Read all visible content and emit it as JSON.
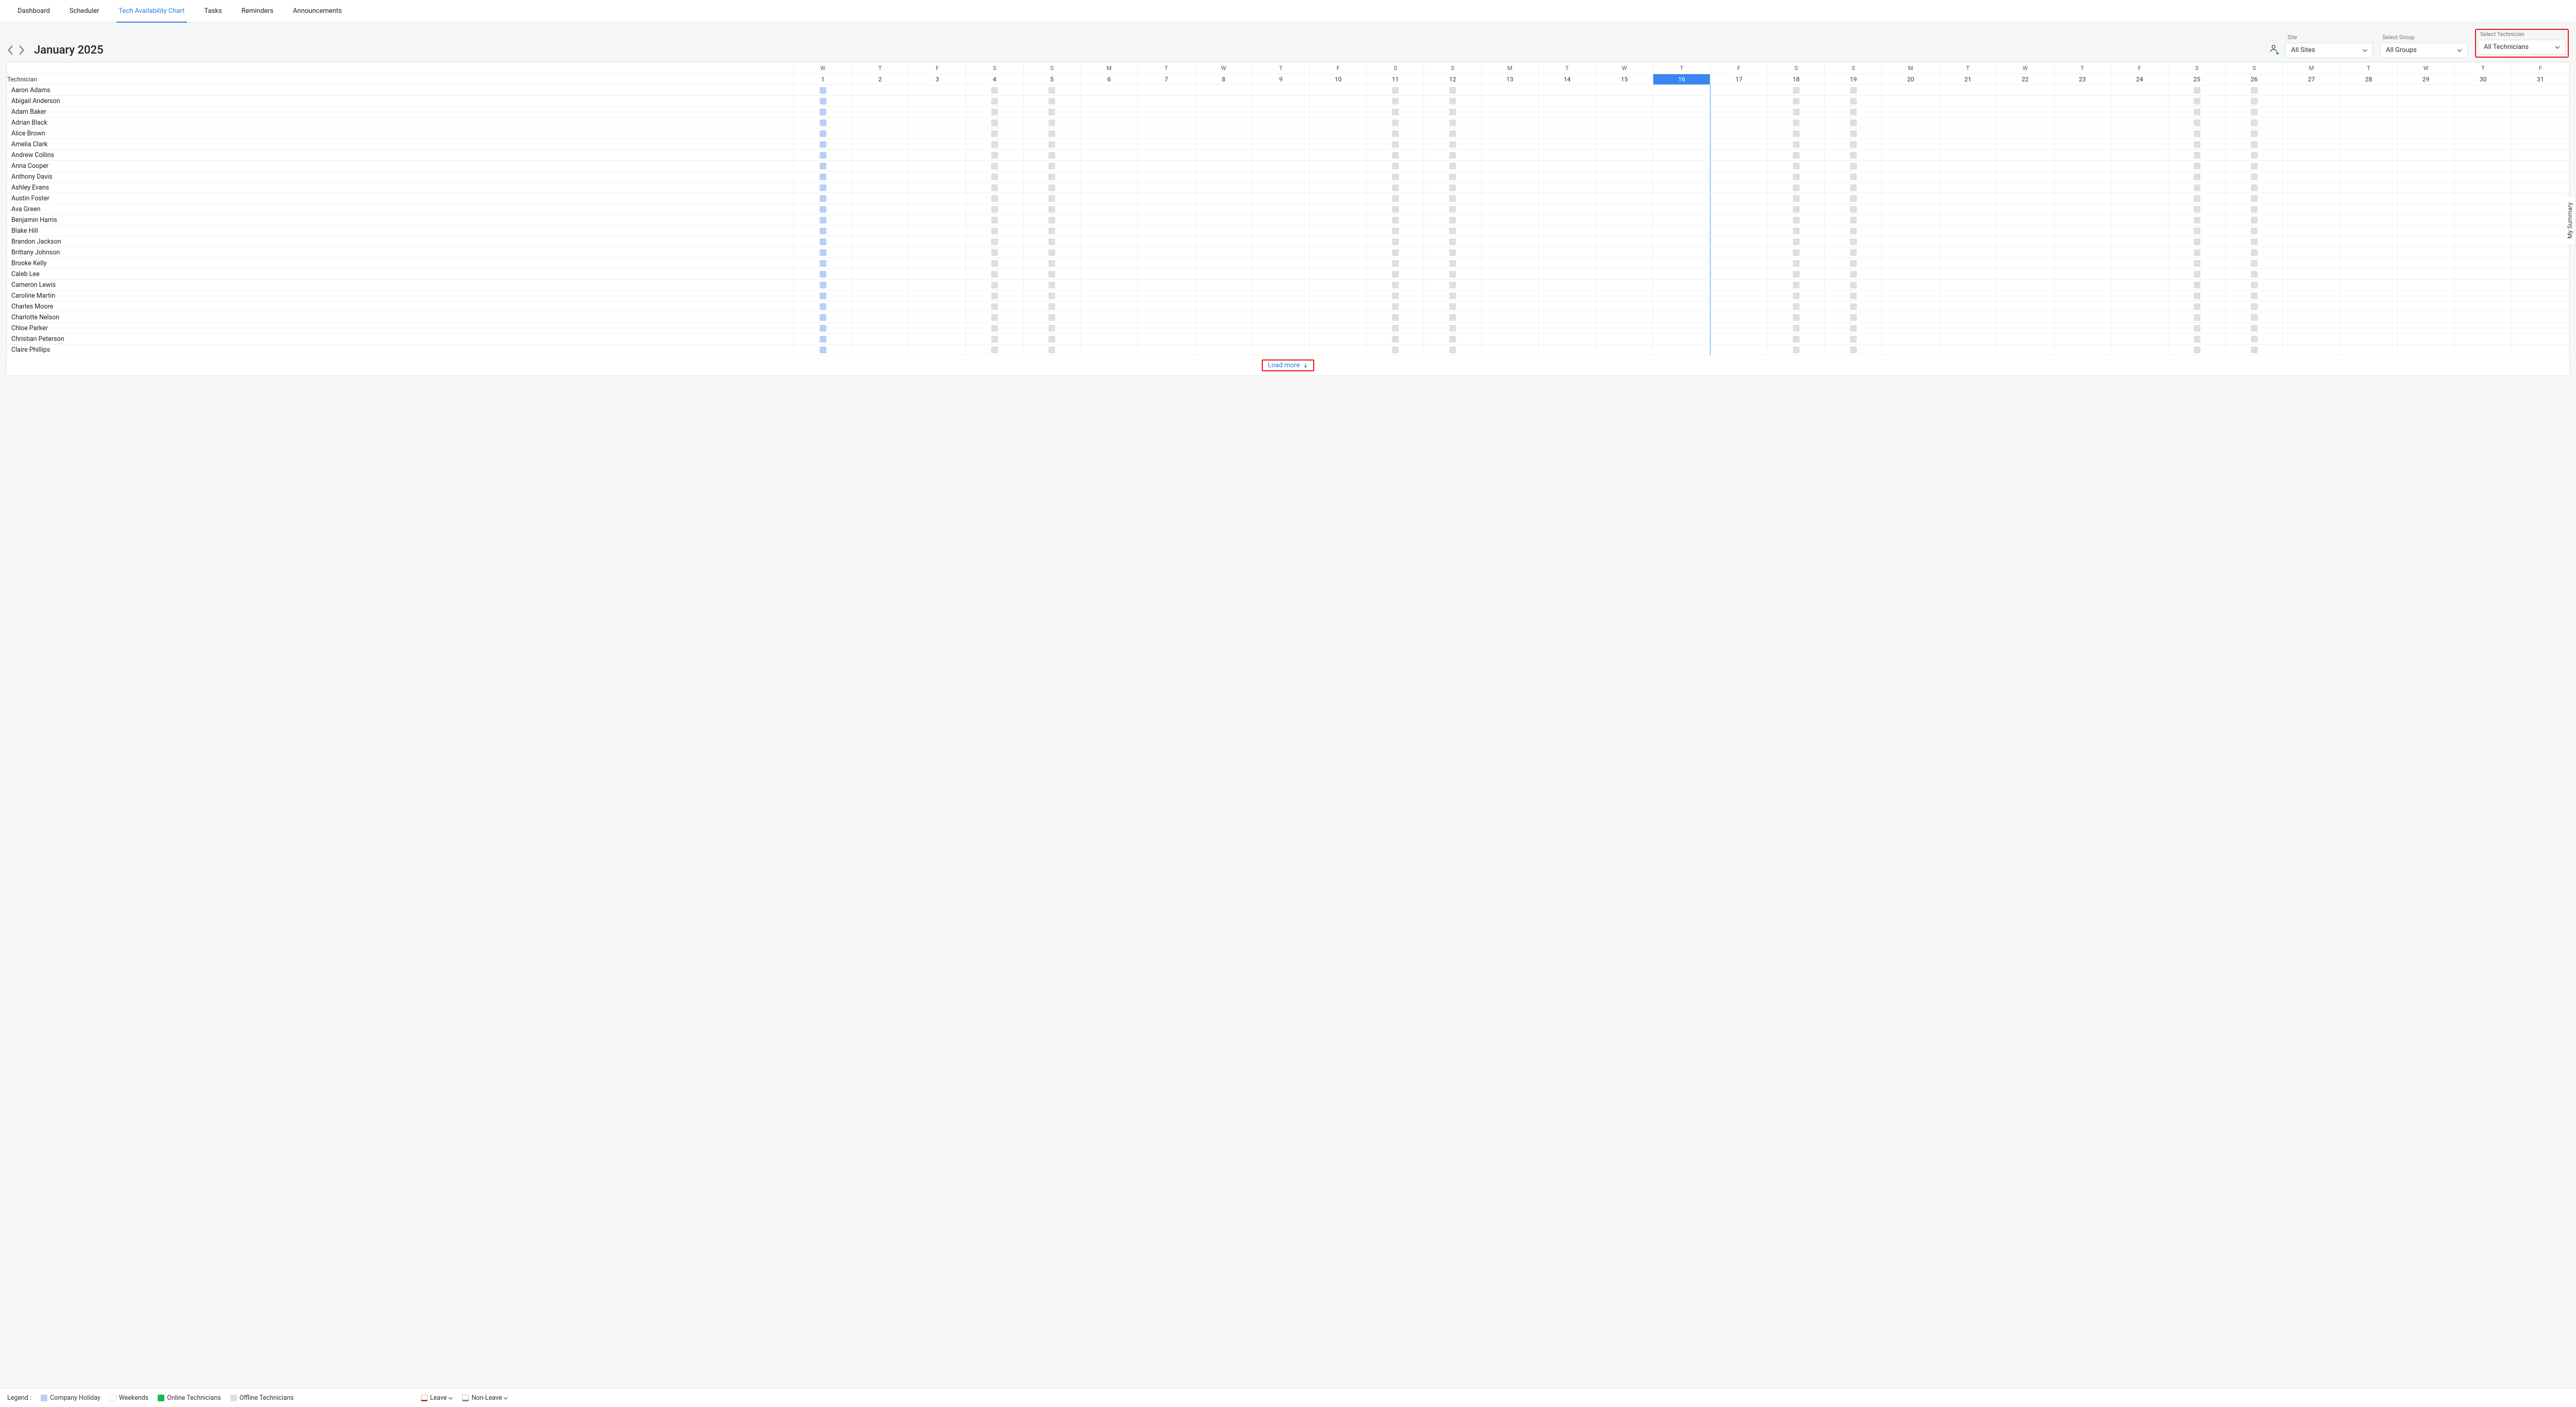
{
  "tabs": [
    "Dashboard",
    "Scheduler",
    "Tech Availability Chart",
    "Tasks",
    "Reminders",
    "Announcements"
  ],
  "activeTab": 2,
  "month": "January 2025",
  "filters": {
    "site": {
      "label": "Site",
      "value": "All Sites"
    },
    "group": {
      "label": "Select Group",
      "value": "All Groups"
    },
    "tech": {
      "label": "Select Technician",
      "value": "All Technicians"
    }
  },
  "technicianColHeader": "Technician",
  "weekdays": [
    "W",
    "T",
    "F",
    "S",
    "S",
    "M",
    "T",
    "W",
    "T",
    "F",
    "S",
    "S",
    "M",
    "T",
    "W",
    "T",
    "F",
    "S",
    "S",
    "M",
    "T",
    "W",
    "T",
    "F",
    "S",
    "S",
    "M",
    "T",
    "W",
    "T",
    "F"
  ],
  "dates": [
    1,
    2,
    3,
    4,
    5,
    6,
    7,
    8,
    9,
    10,
    11,
    12,
    13,
    14,
    15,
    16,
    17,
    18,
    19,
    20,
    21,
    22,
    23,
    24,
    25,
    26,
    27,
    28,
    29,
    30,
    31
  ],
  "today": 16,
  "holidayCols": [
    1
  ],
  "weekendCols": [
    4,
    5,
    11,
    12,
    18,
    19,
    25,
    26
  ],
  "technicians": [
    "Aaron Adams",
    "Abigail Anderson",
    "Adam Baker",
    "Adrian Black",
    "Alice Brown",
    "Amelia Clark",
    "Andrew Collins",
    "Anna Cooper",
    "Anthony Davis",
    "Ashley Evans",
    "Austin Foster",
    "Ava Green",
    "Benjamin Harris",
    "Blake Hill",
    "Brandon Jackson",
    "Brittany Johnson",
    "Brooke Kelly",
    "Caleb Lee",
    "Cameron Lewis",
    "Caroline Martin",
    "Charles Moore",
    "Charlotte Nelson",
    "Chloe Parker",
    "Christian Peterson",
    "Claire Phillips"
  ],
  "loadMore": "Load more",
  "legend": {
    "title": "Legend :",
    "holiday": "Company Holiday",
    "weekends": "Weekends",
    "online": "Online Technicians",
    "offline": "Offline Technicians",
    "leave": "Leave",
    "nonleave": "Non-Leave"
  },
  "sideTab": "My Summary"
}
